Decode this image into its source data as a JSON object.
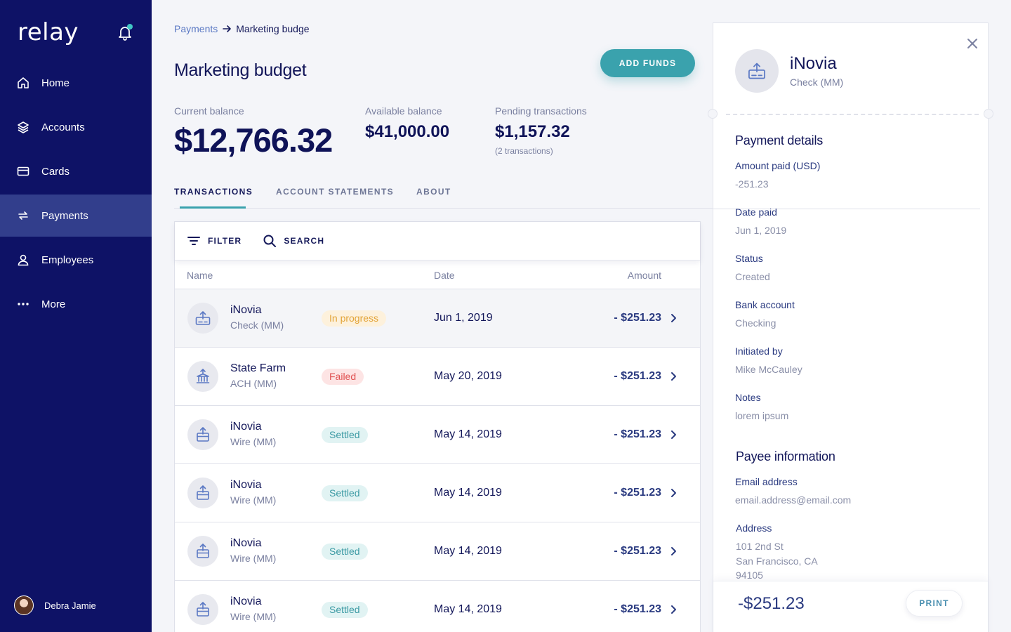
{
  "app": {
    "logo": "relay"
  },
  "sidebar": {
    "items": [
      {
        "label": "Home",
        "icon": "home-icon",
        "active": false
      },
      {
        "label": "Accounts",
        "icon": "layers-icon",
        "active": false
      },
      {
        "label": "Cards",
        "icon": "card-icon",
        "active": false
      },
      {
        "label": "Payments",
        "icon": "transfer-icon",
        "active": true
      },
      {
        "label": "Employees",
        "icon": "person-icon",
        "active": false
      },
      {
        "label": "More",
        "icon": "more-icon",
        "active": false
      }
    ],
    "user": {
      "name": "Debra Jamie"
    }
  },
  "breadcrumb": {
    "parent": "Payments",
    "current": "Marketing budge"
  },
  "page": {
    "title": "Marketing budget",
    "add_funds_label": "ADD FUNDS"
  },
  "balances": {
    "current": {
      "label": "Current balance",
      "value": "$12,766.32"
    },
    "available": {
      "label": "Available balance",
      "value": "$41,000.00"
    },
    "pending": {
      "label": "Pending transactions",
      "value": "$1,157.32",
      "sub": "(2 transactions)"
    }
  },
  "tabs": [
    {
      "label": "TRANSACTIONS",
      "active": true
    },
    {
      "label": "ACCOUNT STATEMENTS",
      "active": false
    },
    {
      "label": "ABOUT",
      "active": false
    }
  ],
  "toolbar": {
    "filter_label": "FILTER",
    "search_label": "SEARCH"
  },
  "table": {
    "columns": {
      "name": "Name",
      "date": "Date",
      "amount": "Amount"
    },
    "rows": [
      {
        "name": "iNovia",
        "method": "Check (MM)",
        "status": "In progress",
        "status_kind": "progress",
        "date": "Jun 1, 2019",
        "amount": "- $251.23",
        "icon": "check-upload-icon",
        "selected": true
      },
      {
        "name": "State Farm",
        "method": "ACH (MM)",
        "status": "Failed",
        "status_kind": "failed",
        "date": "May 20, 2019",
        "amount": "- $251.23",
        "icon": "bank-upload-icon",
        "selected": false
      },
      {
        "name": "iNovia",
        "method": "Wire (MM)",
        "status": "Settled",
        "status_kind": "settled",
        "date": "May 14, 2019",
        "amount": "- $251.23",
        "icon": "wire-upload-icon",
        "selected": false
      },
      {
        "name": "iNovia",
        "method": "Wire (MM)",
        "status": "Settled",
        "status_kind": "settled",
        "date": "May 14, 2019",
        "amount": "- $251.23",
        "icon": "wire-upload-icon",
        "selected": false
      },
      {
        "name": "iNovia",
        "method": "Wire (MM)",
        "status": "Settled",
        "status_kind": "settled",
        "date": "May 14, 2019",
        "amount": "- $251.23",
        "icon": "wire-upload-icon",
        "selected": false
      },
      {
        "name": "iNovia",
        "method": "Wire (MM)",
        "status": "Settled",
        "status_kind": "settled",
        "date": "May 14, 2019",
        "amount": "- $251.23",
        "icon": "wire-upload-icon",
        "selected": false
      }
    ]
  },
  "detail": {
    "payee_name": "iNovia",
    "payee_type": "Check (MM)",
    "payment_section_title": "Payment details",
    "fields": [
      {
        "label": "Amount paid (USD)",
        "value": "-251.23"
      },
      {
        "label": "Date paid",
        "value": "Jun 1, 2019"
      },
      {
        "label": "Status",
        "value": "Created"
      },
      {
        "label": "Bank account",
        "value": "Checking"
      },
      {
        "label": "Initiated by",
        "value": "Mike McCauley"
      },
      {
        "label": "Notes",
        "value": "lorem ipsum"
      }
    ],
    "payee_section_title": "Payee information",
    "payee_fields": [
      {
        "label": "Email address",
        "value": "email.address@email.com"
      },
      {
        "label": "Address",
        "lines": [
          "101 2nd St",
          "San Francisco, CA",
          "94105"
        ]
      }
    ],
    "footer_amount": "-$251.23",
    "print_label": "PRINT"
  },
  "colors": {
    "sidebar_bg": "#0e1266",
    "sidebar_active": "#323e8c",
    "accent_teal": "#3aa2ad",
    "badge_progress": "#e2a336",
    "badge_failed": "#e05252",
    "badge_settled": "#3a99a3"
  }
}
